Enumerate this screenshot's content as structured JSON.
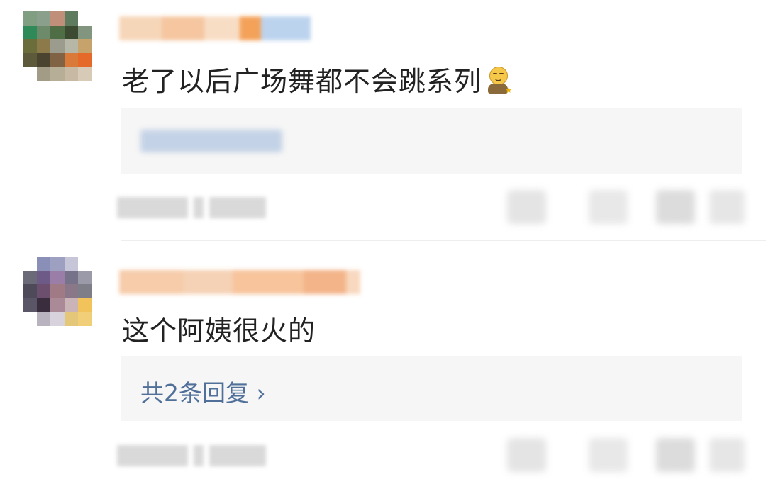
{
  "comments": [
    {
      "text": "老了以后广场舞都不会跳系列",
      "emoji": "smiling-face-emoji",
      "reply_link": ""
    },
    {
      "text": "这个阿姨很火的",
      "reply_link": "共2条回复 ›"
    }
  ],
  "colors": {
    "text": "#222222",
    "reply_link": "#50709a",
    "reply_box": "#f6f6f6"
  }
}
